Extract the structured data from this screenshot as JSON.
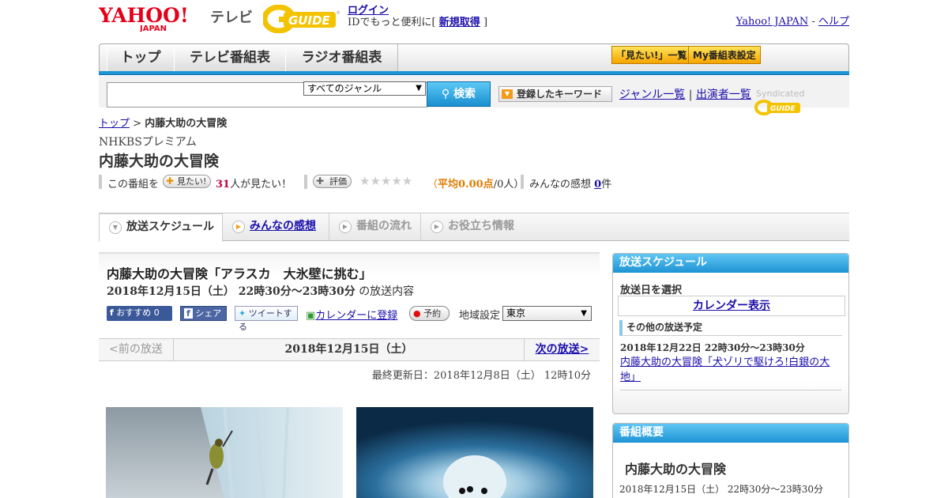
{
  "header": {
    "yahoo_logo": "YAHOO! JAPAN",
    "tv_label": "テレビ",
    "gguide_logo": "G-GUIDE",
    "login": "ログイン",
    "login_note_prefix": "IDでもっと便利に[",
    "signup": "新規取得",
    "login_note_suffix": "]",
    "yahoo_japan_link": "Yahoo! JAPAN",
    "link_sep": "-",
    "help_link": "ヘルプ"
  },
  "nav": {
    "tabs": [
      "トップ",
      "テレビ番組表",
      "ラジオ番組表"
    ],
    "want_list": "「見たい!」一覧",
    "my_schedule": "My番組表設定"
  },
  "search": {
    "genre_value": "すべてのジャンル",
    "button": "検索",
    "keyword_button": "登録したキーワード",
    "genre_list": "ジャンル一覧",
    "sep": "|",
    "cast_list": "出演者一覧",
    "syndicated": "Syndicated"
  },
  "breadcrumb": {
    "top": "トップ",
    "sep": ">",
    "current": "内藤大助の大冒険"
  },
  "program": {
    "channel": "NHKBSプレミアム",
    "title": "内藤大助の大冒険",
    "this_program": "この番組を",
    "want_btn": "見たい!",
    "want_count": "31",
    "want_suffix": "人が見たい！",
    "rate_btn": "評価",
    "stars": "★★★★★",
    "avg_open": "（",
    "avg_label": "平均0.00点",
    "avg_people": "/0人）",
    "impressions_label": "みんなの感想",
    "impressions_count": "0",
    "impressions_suffix": "件"
  },
  "content_tabs": [
    "放送スケジュール",
    "みんなの感想",
    "番組の流れ",
    "お役立ち情報"
  ],
  "episode": {
    "title": "内藤大助の大冒険「アラスカ　大氷壁に挑む」",
    "datetime": "2018年12月15日（土）  22時30分～23時30分",
    "datetime_suffix": "の放送内容",
    "recommend": "おすすめ",
    "recommend_count": "0",
    "share": "シェア",
    "tweet": "ツイートする",
    "calendar": "カレンダーに登録",
    "reserve": "予約",
    "region_label": "地域設定",
    "region_value": "東京"
  },
  "pager": {
    "prev": "<前の放送",
    "current": "2018年12月15日（土）",
    "next": "次の放送>"
  },
  "updated": "最終更新日：2018年12月8日（土）  12時10分",
  "sidebar": {
    "schedule_title": "放送スケジュール",
    "select_date": "放送日を選択",
    "calendar_show": "カレンダー表示",
    "other_title": "その他の放送予定",
    "other_datetime": "2018年12月22日  22時30分～23時30分",
    "other_link": "内藤大助の大冒険「犬ゾリで駆けろ!白銀の大地」",
    "overview_title": "番組概要",
    "overview_name": "内藤大助の大冒険",
    "overview_time": "2018年12月15日（土）  22時30分～23時30分"
  },
  "colors": {
    "accent_blue": "#1d95d5",
    "link": "#1a0dab",
    "want_count": "#c0004a",
    "avg": "#e07b00"
  }
}
